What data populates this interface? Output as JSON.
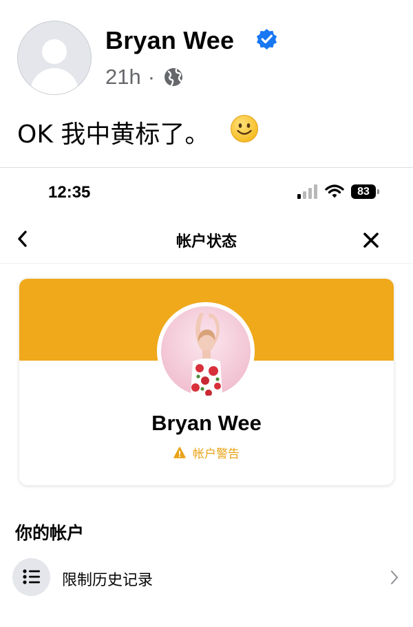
{
  "post": {
    "author": "Bryan Wee",
    "time": "21h",
    "separator": "·",
    "text": "OK 我中黄标了。",
    "icons": [
      "default-avatar-icon",
      "verified-badge-icon",
      "globe-icon",
      "smiley-emoji-icon"
    ]
  },
  "phone": {
    "status_bar": {
      "time": "12:35",
      "battery": "83"
    },
    "nav": {
      "title": "帐户状态"
    },
    "profile_card": {
      "name": "Bryan Wee",
      "warning": "帐户警告",
      "banner_color": "#EFA91B",
      "warning_color": "#E8A317"
    },
    "section": {
      "title": "你的帐户",
      "items": [
        {
          "label": "限制历史记录",
          "icon": "list-icon"
        }
      ]
    }
  },
  "colors": {
    "verified_blue": "#1877F2",
    "secondary_text": "#65676B",
    "divider": "#DADDE1"
  }
}
